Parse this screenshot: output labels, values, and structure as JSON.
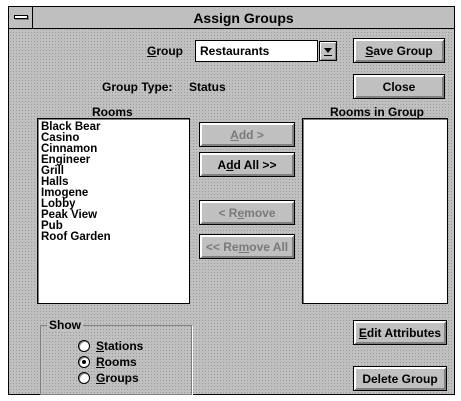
{
  "window": {
    "title": "Assign Groups"
  },
  "group": {
    "label_pre": "",
    "label_ul": "G",
    "label_post": "roup",
    "value": "Restaurants",
    "type_label": "Group Type:",
    "type_value": "Status"
  },
  "buttons": {
    "save_group": {
      "pre": "",
      "ul": "S",
      "post": "ave Group"
    },
    "close": {
      "pre": "Close",
      "ul": "",
      "post": ""
    },
    "add": {
      "pre": "",
      "ul": "A",
      "post": "dd >"
    },
    "add_all": {
      "pre": "A",
      "ul": "d",
      "post": "d All >>"
    },
    "remove": {
      "pre": "< R",
      "ul": "e",
      "post": "move"
    },
    "remove_all": {
      "pre": "<< Re",
      "ul": "m",
      "post": "ove All"
    },
    "edit_attributes": {
      "pre": "",
      "ul": "E",
      "post": "dit Attributes"
    },
    "delete_group": {
      "pre": "Delete Group",
      "ul": "",
      "post": ""
    }
  },
  "rooms": {
    "label": "Rooms",
    "items": [
      "Black Bear",
      "Casino",
      "Cinnamon",
      "Engineer",
      "Grill",
      "Halls",
      "Imogene",
      "Lobby",
      "Peak View",
      "Pub",
      "Roof Garden"
    ]
  },
  "rooms_in_group": {
    "label": "Rooms in Group",
    "items": []
  },
  "show": {
    "label": "Show",
    "options": [
      {
        "pre": "",
        "ul": "S",
        "post": "tations",
        "checked": false
      },
      {
        "pre": "",
        "ul": "R",
        "post": "ooms",
        "checked": true
      },
      {
        "pre": "",
        "ul": "G",
        "post": "roups",
        "checked": false
      }
    ]
  }
}
